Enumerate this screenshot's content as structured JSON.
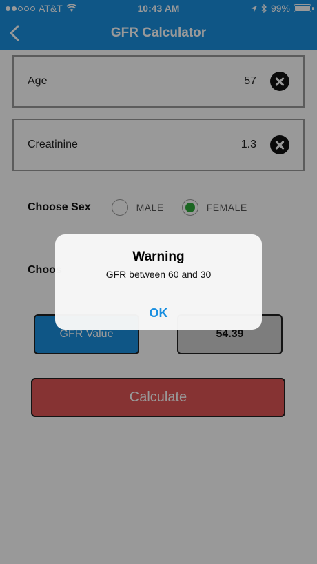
{
  "status_bar": {
    "carrier": "AT&T",
    "time": "10:43 AM",
    "battery": "99%",
    "battery_level": 0.99
  },
  "nav": {
    "title": "GFR Calculator"
  },
  "fields": {
    "age": {
      "label": "Age",
      "value": "57"
    },
    "creatinine": {
      "label": "Creatinine",
      "value": "1.3"
    }
  },
  "sex": {
    "label": "Choose Sex",
    "options": [
      {
        "label": "MALE",
        "selected": false
      },
      {
        "label": "FEMALE",
        "selected": true
      }
    ]
  },
  "choose_partial": "Choos",
  "gfr": {
    "button_label": "GFR Value",
    "result": "54.39"
  },
  "calculate_label": "Calculate",
  "alert": {
    "title": "Warning",
    "message": "GFR between 60 and 30",
    "ok_label": "OK"
  },
  "colors": {
    "accent": "#1a8fe0",
    "calculate": "#e05555",
    "radio_selected": "#2eaa3a"
  }
}
